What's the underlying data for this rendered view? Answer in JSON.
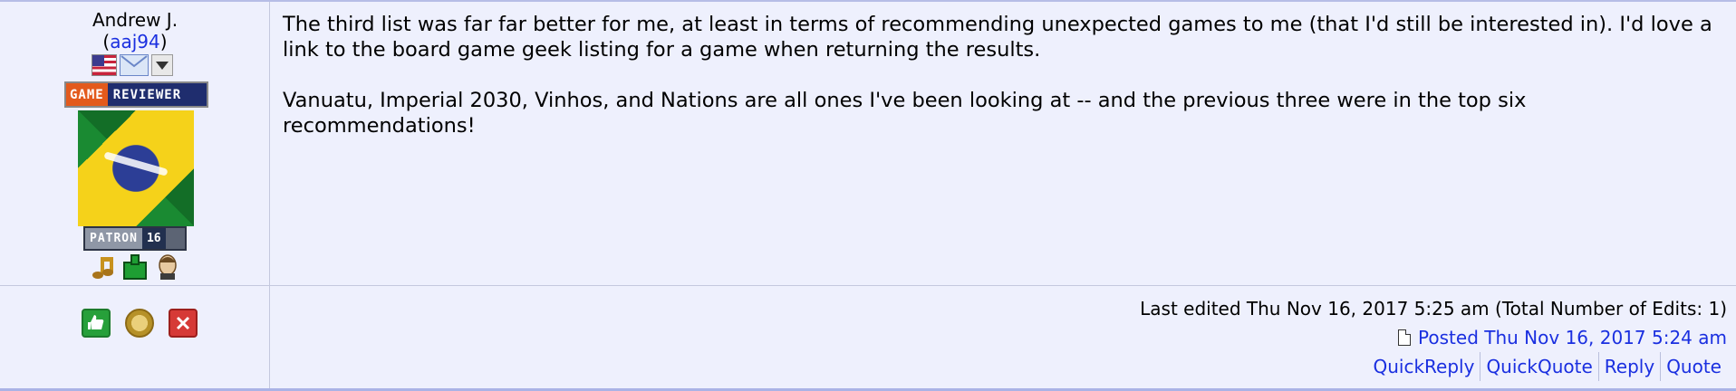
{
  "user": {
    "display_name": "Andrew J.",
    "handle_open": "(",
    "handle": "aaj94",
    "handle_close": ")",
    "badge_game": "GAME",
    "badge_reviewer": "REVIEWER",
    "patron_label": "PATRON",
    "patron_years": "16"
  },
  "message": {
    "paragraph1": "The third list was far far better for me, at least in terms of recommending unexpected games to me (that I'd still be interested in). I'd love a link to the board game geek listing for a game when returning the results.",
    "paragraph2": "Vanuatu, Imperial 2030, Vinhos, and Nations are all ones I've been looking at -- and the previous three were in the top six recommendations!"
  },
  "meta": {
    "edited": "Last edited Thu Nov 16, 2017 5:25 am (Total Number of Edits: 1)",
    "posted": "Posted Thu Nov 16, 2017 5:24 am"
  },
  "links": {
    "quick_reply": "QuickReply",
    "quick_quote": "QuickQuote",
    "reply": "Reply",
    "quote": "Quote"
  },
  "colors": {
    "background": "#eef0fd",
    "link": "#1a2fe0",
    "divider": "#c4c8de"
  }
}
